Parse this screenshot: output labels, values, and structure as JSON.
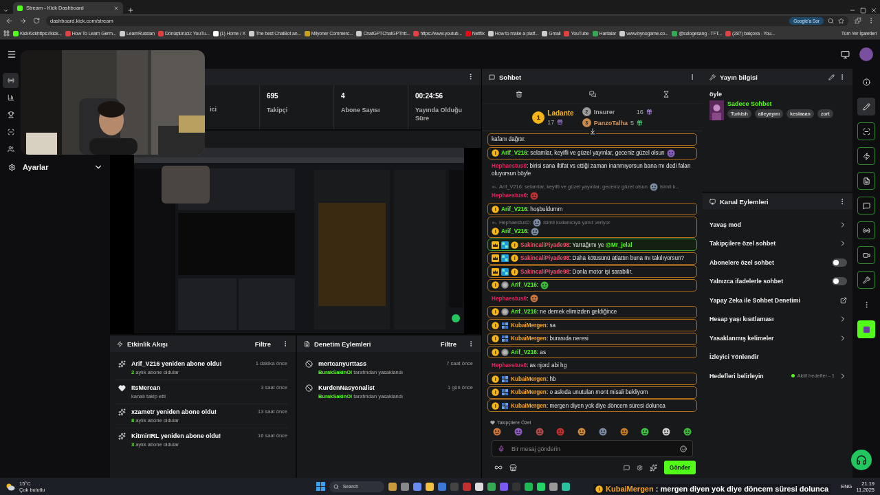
{
  "browser": {
    "tab_title": "Stream - Kick Dashboard",
    "url": "dashboard.kick.com/stream",
    "ask_button": "Google'a Sor",
    "bookmarks": [
      {
        "label": "KickKickhttps://kick...",
        "color": "#53fc18"
      },
      {
        "label": "How To Learn Germ...",
        "color": "#e04040"
      },
      {
        "label": "LearnRussian",
        "color": "#cccccc"
      },
      {
        "label": "Dönüştürücü: YouTu...",
        "color": "#e04040"
      },
      {
        "label": "(1) Home / X",
        "color": "#ffffff"
      },
      {
        "label": "The best ChatBot an...",
        "color": "#cccccc"
      },
      {
        "label": "Milyoner Commerc...",
        "color": "#c8a020"
      },
      {
        "label": "ChatGPTChatGPThtt...",
        "color": "#cccccc"
      },
      {
        "label": "https://www.youtub...",
        "color": "#e04040"
      },
      {
        "label": "Netflix",
        "color": "#e50914"
      },
      {
        "label": "How to make a platf...",
        "color": "#cccccc"
      },
      {
        "label": "Gmail",
        "color": "#cccccc"
      },
      {
        "label": "YouTube",
        "color": "#e04040"
      },
      {
        "label": "Haritalar",
        "color": "#34a853"
      },
      {
        "label": "www.bynogame.co...",
        "color": "#cccccc"
      },
      {
        "label": "@sologesang - TFT...",
        "color": "#34a853"
      },
      {
        "label": "(287) balçova - You...",
        "color": "#e04040"
      }
    ],
    "all_bookmarks": "Tüm Yer İşaretleri"
  },
  "sidebar": {
    "items": [
      {
        "kind": "live",
        "selected": true
      },
      {
        "kind": "stats",
        "selected": false
      },
      {
        "kind": "trophy",
        "selected": false
      },
      {
        "kind": "capture",
        "selected": false
      },
      {
        "kind": "users",
        "selected": false
      }
    ],
    "settings": {
      "label": "Ayarlar",
      "expanded": false
    }
  },
  "stats": [
    {
      "label": "ici"
    },
    {
      "value": "695",
      "label": "Takipçi"
    },
    {
      "value": "4",
      "label": "Abone Sayısı"
    },
    {
      "value": "00:24:56",
      "label": "Yayında Olduğu Süre"
    }
  ],
  "activity": {
    "title": "Etkinlik Akışı",
    "filter": "Filtre",
    "items": [
      {
        "kind": "resub",
        "title": "Arif_V216 yeniden abone oldu!",
        "count": "2",
        "detail": " aylık abone oldular",
        "time": "1 dakika önce"
      },
      {
        "kind": "follow",
        "title": "ItsMercan",
        "detail": "kanalı takip etti",
        "time": "3 saat önce"
      },
      {
        "kind": "resub",
        "title": "xzametr yeniden abone oldu!",
        "count": "8",
        "detail": " aylık abone oldular",
        "time": "13 saat önce"
      },
      {
        "kind": "resub",
        "title": "KitmirIRL yeniden abone oldu!",
        "count": "3",
        "detail": " aylık abone oldular",
        "time": "16 saat önce"
      }
    ]
  },
  "moderation": {
    "title": "Denetim Eylemleri",
    "filter": "Filtre",
    "items": [
      {
        "user": "mertcanyurttass",
        "moderator": "BurakSakinOl",
        "detail": " tarafından yasaklandı",
        "time": "7 saat önce"
      },
      {
        "user": "KurdenNasyonalist",
        "moderator": "BurakSakinOl",
        "detail": " tarafından yasaklandı",
        "time": "1 gün önce"
      }
    ]
  },
  "chat": {
    "title": "Sohbet",
    "leaders": [
      {
        "rank": "1",
        "name": "Ladante",
        "count": "17"
      },
      {
        "rank": "2",
        "name": "Insurer",
        "count": "16"
      },
      {
        "rank": "3",
        "name": "PanzoTalha",
        "count": "5"
      }
    ],
    "messages": [
      {
        "kind": "highlight",
        "text": "kafanı dağıtır."
      },
      {
        "kind": "highlight",
        "badges": [
          {
            "kind": "sub"
          }
        ],
        "user": "Arif_V216",
        "color": "#53fc18",
        "text": ": selamlar, keyifli ve güzel yayınlar, geceniz güzel olsun",
        "emote": true
      },
      {
        "kind": "plain",
        "user": "Hephaestus0",
        "color": "#e0245e",
        "text": ": birisi sana iltifat vs ettiği zaman inanmıyorsun bana mı dedi falan oluyorsun böyle"
      },
      {
        "kind": "plain",
        "reply": {
          "text": "Arif_V216: selamlar, keyifli ve güzel yayınlar, geceniz güzel olsun",
          "after": "isimli k..."
        },
        "user": "Hephaestus0",
        "color": "#e0245e",
        "text": ":",
        "emote": true
      },
      {
        "kind": "highlight",
        "badges": [
          {
            "kind": "sub"
          }
        ],
        "user": "Arif_V216",
        "color": "#53fc18",
        "text": ": hoşbuldumm"
      },
      {
        "kind": "highlight",
        "reply": {
          "text": "Hephaestus0:",
          "after": "isimli kullanıcıya yanıt veriyor"
        },
        "badges": [
          {
            "kind": "sub"
          }
        ],
        "user": "Arif_V216",
        "color": "#53fc18",
        "text": ":",
        "emote": true
      },
      {
        "kind": "mention",
        "badges": [
          {
            "kind": "crown"
          },
          {
            "kind": "og"
          },
          {
            "kind": "sub"
          }
        ],
        "user": "SakincaliPiyade98",
        "color": "#f0506e",
        "text": ": Yarrağımı ye ",
        "mention": "@Mr_jelal"
      },
      {
        "kind": "highlight",
        "badges": [
          {
            "kind": "crown"
          },
          {
            "kind": "og"
          },
          {
            "kind": "sub"
          }
        ],
        "user": "SakincaliPiyade98",
        "color": "#f0506e",
        "text": ": Daha kötüsünü atlattın buna mı takılıyorsun?"
      },
      {
        "kind": "highlight",
        "badges": [
          {
            "kind": "crown"
          },
          {
            "kind": "og"
          },
          {
            "kind": "sub"
          }
        ],
        "user": "SakincaliPiyade98",
        "color": "#f0506e",
        "text": ": Donla motor işi sarabilir."
      },
      {
        "kind": "highlight",
        "badges": [
          {
            "kind": "sub"
          },
          {
            "kind": "silver"
          }
        ],
        "user": "Arif_V216",
        "color": "#53fc18",
        "text": ":",
        "emote": true
      },
      {
        "kind": "plain",
        "user": "Hephaestus0",
        "color": "#e0245e",
        "text": ":",
        "emote": true
      },
      {
        "kind": "highlight",
        "badges": [
          {
            "kind": "sub"
          },
          {
            "kind": "silver"
          }
        ],
        "user": "Arif_V216",
        "color": "#53fc18",
        "text": ": ne demek elimizden geldiğince"
      },
      {
        "kind": "highlight",
        "badges": [
          {
            "kind": "sub"
          },
          {
            "kind": "vip"
          }
        ],
        "user": "KubaiMergen",
        "color": "#f5a623",
        "text": ": sa"
      },
      {
        "kind": "highlight",
        "badges": [
          {
            "kind": "sub"
          },
          {
            "kind": "vip"
          }
        ],
        "user": "KubaiMergen",
        "color": "#f5a623",
        "text": ": burasıda neresi"
      },
      {
        "kind": "highlight",
        "badges": [
          {
            "kind": "sub"
          },
          {
            "kind": "silver"
          }
        ],
        "user": "Arif_V216",
        "color": "#53fc18",
        "text": ": as"
      },
      {
        "kind": "plain",
        "user": "Hephaestus0",
        "color": "#e0245e",
        "text": ": as njord abi hg"
      },
      {
        "kind": "highlight",
        "badges": [
          {
            "kind": "sub"
          },
          {
            "kind": "vip"
          }
        ],
        "user": "KubaiMergen",
        "color": "#f5a623",
        "text": ": hb"
      },
      {
        "kind": "highlight",
        "badges": [
          {
            "kind": "sub"
          },
          {
            "kind": "vip"
          }
        ],
        "user": "KubaiMergen",
        "color": "#f5a623",
        "text": ": o askıda unutulan mont misali bekliyom"
      },
      {
        "kind": "highlight",
        "badges": [
          {
            "kind": "sub"
          },
          {
            "kind": "vip"
          }
        ],
        "user": "KubaiMergen",
        "color": "#f5a623",
        "text": ": mergen diyen yok diye döncem süresi dolunca"
      }
    ],
    "emote_set": "Takipçilere Özel",
    "placeholder": "Bir mesaj gönderin",
    "send": "Gönder"
  },
  "stream_info": {
    "title": "Yayın bilgisi",
    "stream_title": "öyle",
    "category": "Sadece Sohbet",
    "tags": [
      "Turkish",
      "aileyayını",
      "keslaaan",
      "zort"
    ]
  },
  "channel_actions": {
    "title": "Kanal Eylemleri",
    "items": [
      {
        "kind": "arrow",
        "label": "Yavaş mod"
      },
      {
        "kind": "arrow",
        "label": "Takipçilere özel sohbet"
      },
      {
        "kind": "toggle",
        "label": "Abonelere özel sohbet",
        "on": false
      },
      {
        "kind": "toggle",
        "label": "Yalnızca ifadelerle sohbet",
        "on": false
      },
      {
        "kind": "external",
        "label": "Yapay Zeka ile Sohbet Denetimi"
      },
      {
        "kind": "arrow",
        "label": "Hesap yaşı kısıtlaması"
      },
      {
        "kind": "arrow",
        "label": "Yasaklanmış kelimeler"
      },
      {
        "kind": "plain",
        "label": "İzleyici Yönlendir"
      },
      {
        "kind": "goal",
        "label": "Hedefleri belirleyin",
        "status": "Aktif hedefler - 1"
      }
    ]
  },
  "rail": [
    {
      "kind": "info",
      "selected": false
    },
    {
      "kind": "edit",
      "selected": true
    },
    {
      "kind": "capture",
      "selected": false
    },
    {
      "kind": "bolt",
      "selected": false
    },
    {
      "kind": "note",
      "selected": false
    },
    {
      "kind": "chat",
      "selected": false
    },
    {
      "kind": "broadcast",
      "selected": false
    },
    {
      "kind": "camera",
      "selected": false
    },
    {
      "kind": "wrench",
      "selected": false
    },
    {
      "kind": "dots",
      "selected": false
    },
    {
      "kind": "app",
      "selected": false
    }
  ],
  "notification": {
    "user": "KubaiMergen",
    "text": " : mergen diyen yok diye döncem süresi dolunca"
  },
  "taskbar": {
    "temperature": "15°C",
    "weather": "Çok bulutlu",
    "search": {
      "placeholder": "Search"
    },
    "language": "ENG",
    "time": "21:19",
    "date": "11.2025"
  }
}
